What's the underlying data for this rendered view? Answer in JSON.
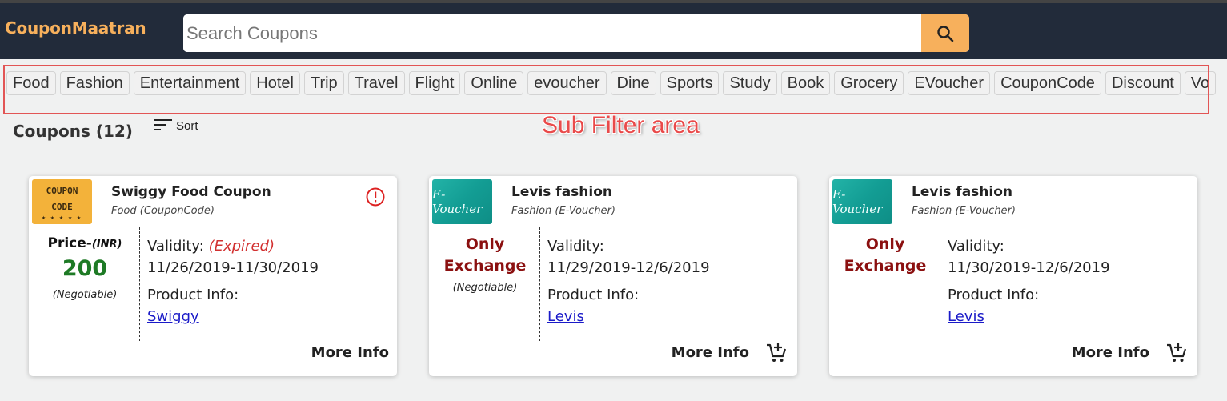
{
  "header": {
    "logo": "CouponMaatran",
    "search_placeholder": "Search Coupons",
    "colors": {
      "bar": "#222b3a",
      "accent": "#f7b05c"
    }
  },
  "filters": [
    "Food",
    "Fashion",
    "Entertainment",
    "Hotel",
    "Trip",
    "Travel",
    "Flight",
    "Online",
    "evoucher",
    "Dine",
    "Sports",
    "Study",
    "Book",
    "Grocery",
    "EVoucher",
    "CouponCode",
    "Discount",
    "Vo"
  ],
  "annotation": "Sub Filter area",
  "list": {
    "title": "Coupons (12)",
    "sort_label": "Sort"
  },
  "cards": [
    {
      "thumb": "coupon-code-image",
      "thumb_text_1": "COUPON",
      "thumb_text_2": "CODE",
      "thumb_stars": "★ ★ ★ ★ ★",
      "title": "Swiggy Food Coupon",
      "subtitle": "Food (CouponCode)",
      "price_label": "Price-",
      "price_unit": "(INR)",
      "price": "200",
      "negotiable": "(Negotiable)",
      "validity_label": "Validity:",
      "validity_status": "(Expired)",
      "dates": "11/26/2019-11/30/2019",
      "product_label": "Product Info:",
      "product_link": "Swiggy",
      "more_info": "More Info"
    },
    {
      "thumb": "e-voucher-image",
      "thumb_text": "E-Voucher",
      "title": "Levis fashion",
      "subtitle": "Fashion (E-Voucher)",
      "only_1": "Only",
      "only_2": "Exchange",
      "negotiable": "(Negotiable)",
      "validity_label": "Validity:",
      "dates": "11/29/2019-12/6/2019",
      "product_label": "Product Info:",
      "product_link": "Levis",
      "more_info": "More Info"
    },
    {
      "thumb": "e-voucher-image",
      "thumb_text": "E-Voucher",
      "title": "Levis fashion",
      "subtitle": "Fashion (E-Voucher)",
      "only_1": "Only",
      "only_2": "Exchange",
      "validity_label": "Validity:",
      "dates": "11/30/2019-12/6/2019",
      "product_label": "Product Info:",
      "product_link": "Levis",
      "more_info": "More Info"
    }
  ]
}
